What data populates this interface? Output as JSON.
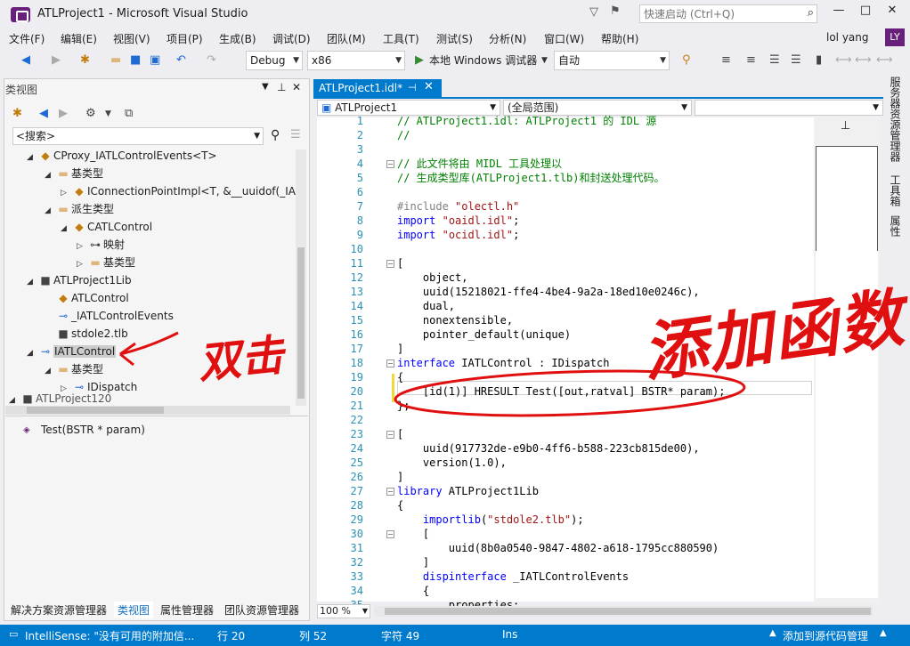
{
  "window": {
    "title": "ATLProject1 - Microsoft Visual Studio",
    "quicklaunch_placeholder": "快速启动 (Ctrl+Q)",
    "minimize": "—",
    "maximize": "□",
    "close": "✕"
  },
  "menu": [
    "文件(F)",
    "编辑(E)",
    "视图(V)",
    "项目(P)",
    "生成(B)",
    "调试(D)",
    "团队(M)",
    "工具(T)",
    "测试(S)",
    "分析(N)",
    "窗口(W)",
    "帮助(H)"
  ],
  "user": {
    "name": "lol yang",
    "initials": "LY"
  },
  "toolbar": {
    "config": "Debug",
    "platform": "x86",
    "run_label": "本地 Windows 调试器",
    "auto": "自动"
  },
  "class_view": {
    "title": "类视图",
    "search_placeholder": "<搜索>",
    "tree": [
      {
        "label": "CProxy_IATLControlEvents<T>",
        "icon": "class"
      },
      {
        "label": "基类型",
        "icon": "folder"
      },
      {
        "label": "IConnectionPointImpl<T, &__uuidof(_IA",
        "icon": "class"
      },
      {
        "label": "派生类型",
        "icon": "folder"
      },
      {
        "label": "CATLControl",
        "icon": "class"
      },
      {
        "label": "映射",
        "icon": "key"
      },
      {
        "label": "基类型",
        "icon": "folder"
      },
      {
        "label": "ATLProject1Lib",
        "icon": "lib"
      },
      {
        "label": "ATLControl",
        "icon": "class"
      },
      {
        "label": "_IATLControlEvents",
        "icon": "iface"
      },
      {
        "label": "stdole2.tlb",
        "icon": "lib"
      },
      {
        "label": "IATLControl",
        "icon": "iface"
      },
      {
        "label": "基类型",
        "icon": "folder"
      },
      {
        "label": "IDispatch",
        "icon": "iface"
      },
      {
        "label": "ATLProject120",
        "icon": "lib"
      }
    ],
    "member": "Test(BSTR * param)"
  },
  "bottom_tabs": [
    "解决方案资源管理器",
    "类视图",
    "属性管理器",
    "团队资源管理器"
  ],
  "editor": {
    "tab_label": "ATLProject1.idl*",
    "nav_left": "ATLProject1",
    "nav_mid": "(全局范围)",
    "nav_right": "",
    "zoom": "100 %",
    "lines": [
      {
        "n": "1",
        "t": "// ATLProject1.idl: ATLProject1 的 IDL 源"
      },
      {
        "n": "2",
        "t": "//"
      },
      {
        "n": "3",
        "t": ""
      },
      {
        "n": "4",
        "t": "// 此文件将由 MIDL 工具处理以"
      },
      {
        "n": "5",
        "t": "// 生成类型库(ATLProject1.tlb)和封送处理代码。"
      },
      {
        "n": "6",
        "t": ""
      },
      {
        "n": "7",
        "t": "#include \"olectl.h\""
      },
      {
        "n": "8",
        "t": "import \"oaidl.idl\";"
      },
      {
        "n": "9",
        "t": "import \"ocidl.idl\";"
      },
      {
        "n": "10",
        "t": ""
      },
      {
        "n": "11",
        "t": "["
      },
      {
        "n": "12",
        "t": "    object,"
      },
      {
        "n": "13",
        "t": "    uuid(15218021-ffe4-4be4-9a2a-18ed10e0246c),"
      },
      {
        "n": "14",
        "t": "    dual,"
      },
      {
        "n": "15",
        "t": "    nonextensible,"
      },
      {
        "n": "16",
        "t": "    pointer_default(unique)"
      },
      {
        "n": "17",
        "t": "]"
      },
      {
        "n": "18",
        "t": "interface IATLControl : IDispatch"
      },
      {
        "n": "19",
        "t": "{"
      },
      {
        "n": "20",
        "t": "    [id(1)] HRESULT Test([out,ratval] BSTR* param);"
      },
      {
        "n": "21",
        "t": "};"
      },
      {
        "n": "22",
        "t": ""
      },
      {
        "n": "23",
        "t": "["
      },
      {
        "n": "24",
        "t": "    uuid(917732de-e9b0-4ff6-b588-223cb815de00),"
      },
      {
        "n": "25",
        "t": "    version(1.0),"
      },
      {
        "n": "26",
        "t": "]"
      },
      {
        "n": "27",
        "t": "library ATLProject1Lib"
      },
      {
        "n": "28",
        "t": "{"
      },
      {
        "n": "29",
        "t": "    importlib(\"stdole2.tlb\");"
      },
      {
        "n": "30",
        "t": "    ["
      },
      {
        "n": "31",
        "t": "        uuid(8b0a0540-9847-4802-a618-1795cc880590)"
      },
      {
        "n": "32",
        "t": "    ]"
      },
      {
        "n": "33",
        "t": "    dispinterface _IATLControlEvents"
      },
      {
        "n": "34",
        "t": "    {"
      },
      {
        "n": "35",
        "t": "        properties:"
      }
    ]
  },
  "right_dock": [
    "服务器资源管理器",
    "工具箱",
    "属性"
  ],
  "status": {
    "intellisense": "IntelliSense: \"没有可用的附加信...",
    "line": "行 20",
    "col": "列 52",
    "char": "字符 49",
    "mode": "Ins",
    "source_control": "添加到源代码管理"
  },
  "annotations": {
    "double_click": "双击",
    "add_function": "添加函数",
    "color": "#e01010"
  }
}
